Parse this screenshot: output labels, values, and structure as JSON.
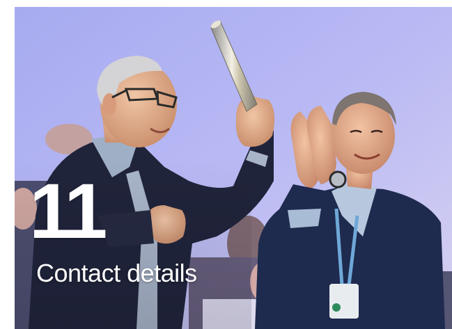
{
  "section": {
    "number": "11",
    "title": "Contact details"
  },
  "hero_image": {
    "subject": "award-ceremony-photo"
  },
  "colors": {
    "backdrop": "#b7b8f4",
    "text": "#ffffff",
    "jacket": "#1f2335",
    "skin": "#e3b394"
  }
}
